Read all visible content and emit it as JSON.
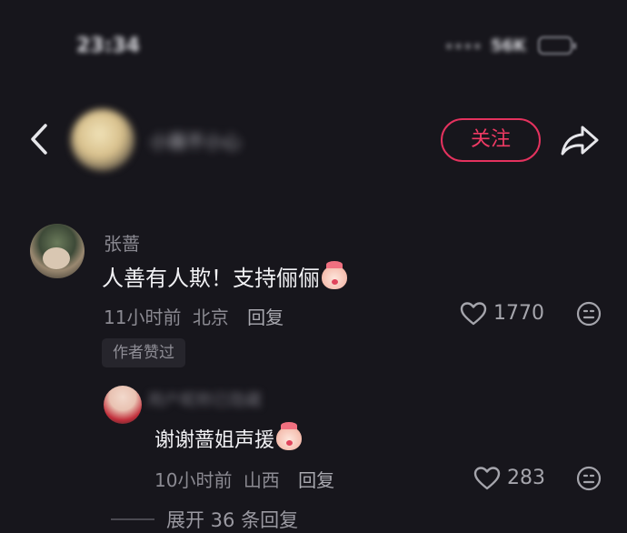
{
  "status_bar": {
    "time": "23:34",
    "signal": "....",
    "network": "56K"
  },
  "header": {
    "back_icon": "chevron-left-icon",
    "user_name": "小薇不小心",
    "follow_label": "关注",
    "share_icon": "share-arrow-icon",
    "accent_color": "#e4325e"
  },
  "comment": {
    "author": "张蔷",
    "text": "人善有人欺！支持俪俪",
    "time": "11小时前",
    "location": "北京",
    "reply_label": "回复",
    "likes": "1770",
    "badge": "作者赞过"
  },
  "reply": {
    "author": "用户昵称已隐藏",
    "text": "谢谢蔷姐声援",
    "time": "10小时前",
    "location": "山西",
    "reply_label": "回复",
    "likes": "283"
  },
  "expand_label": "展开 36 条回复"
}
